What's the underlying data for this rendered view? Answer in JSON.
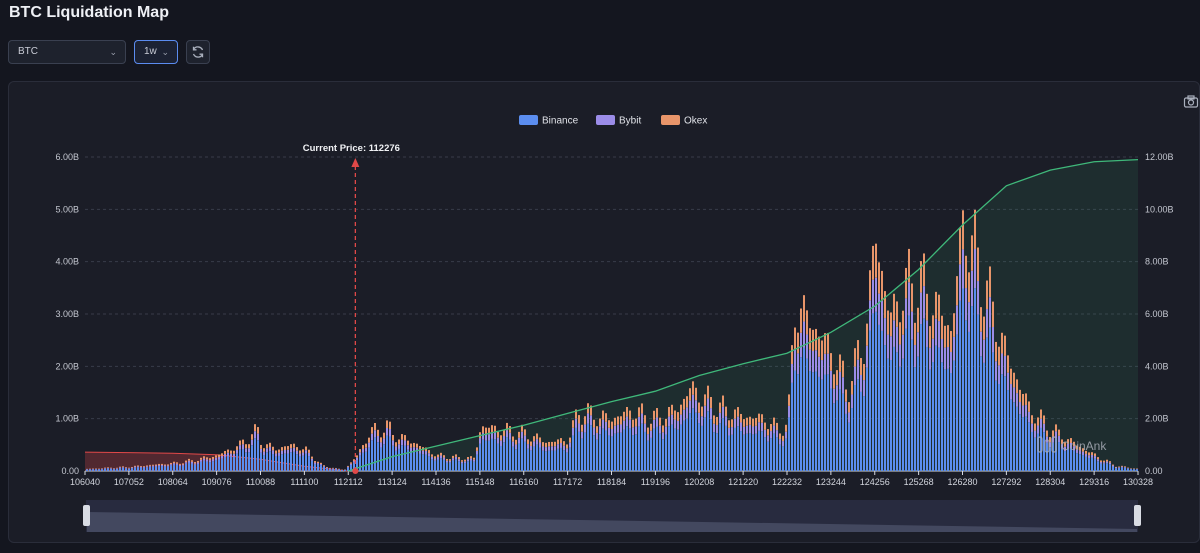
{
  "page": {
    "title": "BTC Liquidation Map"
  },
  "toolbar": {
    "symbol": "BTC",
    "timeframe": "1w"
  },
  "icons": {
    "symbol_dropdown": "chevron-down-icon",
    "timeframe_dropdown": "chevron-down-icon",
    "refresh": "refresh-icon",
    "save_image": "camera-icon"
  },
  "colors": {
    "binance": "#5b8def",
    "bybit": "#9b8ce8",
    "okex": "#e8956a",
    "cumulative_line": "#3fb87a",
    "current_price_marker": "#e04848",
    "short_cumulative": "#e04848"
  },
  "watermark": "CoinAnk",
  "chart_data": {
    "type": "bar",
    "stacked": true,
    "legend": [
      "Binance",
      "Bybit",
      "Okex"
    ],
    "legend_position": "top-center",
    "current_price_label": "Current Price:",
    "current_price": 112276,
    "x_tick_labels": [
      "106040",
      "107052",
      "108064",
      "109076",
      "110088",
      "111100",
      "112112",
      "113124",
      "114136",
      "115148",
      "116160",
      "117172",
      "118184",
      "119196",
      "120208",
      "121220",
      "122232",
      "123244",
      "124256",
      "125268",
      "126280",
      "127292",
      "128304",
      "129316",
      "130328"
    ],
    "y_left": {
      "range": [
        0,
        6
      ],
      "tick_labels": [
        "0.00",
        "1.00B",
        "2.00B",
        "3.00B",
        "4.00B",
        "5.00B",
        "6.00B"
      ]
    },
    "y_right": {
      "range": [
        0,
        12
      ],
      "tick_labels": [
        "0.00",
        "2.00B",
        "4.00B",
        "6.00B",
        "8.00B",
        "10.00B",
        "12.00B"
      ]
    },
    "grid": true,
    "liquidation_profile_billions": [
      [
        106040,
        0.04
      ],
      [
        106500,
        0.06
      ],
      [
        107052,
        0.08
      ],
      [
        107600,
        0.12
      ],
      [
        108064,
        0.15
      ],
      [
        108500,
        0.2
      ],
      [
        109076,
        0.3
      ],
      [
        109600,
        0.5
      ],
      [
        110000,
        0.78
      ],
      [
        110088,
        0.55
      ],
      [
        110400,
        0.42
      ],
      [
        110800,
        0.5
      ],
      [
        111100,
        0.42
      ],
      [
        111500,
        0.1
      ],
      [
        112000,
        0.02
      ],
      [
        112300,
        0.3
      ],
      [
        112600,
        0.75
      ],
      [
        113000,
        0.85
      ],
      [
        113124,
        0.7
      ],
      [
        113600,
        0.55
      ],
      [
        114136,
        0.3
      ],
      [
        114700,
        0.25
      ],
      [
        115000,
        0.25
      ],
      [
        115148,
        0.85
      ],
      [
        115600,
        0.8
      ],
      [
        116160,
        0.72
      ],
      [
        116700,
        0.55
      ],
      [
        117172,
        0.6
      ],
      [
        117400,
        1.15
      ],
      [
        117800,
        1.05
      ],
      [
        118184,
        1.0
      ],
      [
        118600,
        1.15
      ],
      [
        119196,
        1.0
      ],
      [
        119700,
        1.2
      ],
      [
        120000,
        1.6
      ],
      [
        120208,
        1.45
      ],
      [
        120700,
        1.2
      ],
      [
        121220,
        1.05
      ],
      [
        121700,
        1.0
      ],
      [
        122000,
        0.8
      ],
      [
        122232,
        0.9
      ],
      [
        122400,
        3.2
      ],
      [
        122800,
        2.8
      ],
      [
        123244,
        2.3
      ],
      [
        123600,
        1.6
      ],
      [
        124000,
        2.5
      ],
      [
        124256,
        4.5
      ],
      [
        124600,
        2.9
      ],
      [
        124900,
        3.5
      ],
      [
        125268,
        3.6
      ],
      [
        125700,
        3.1
      ],
      [
        126000,
        2.7
      ],
      [
        126280,
        4.8
      ],
      [
        126600,
        4.0
      ],
      [
        127292,
        2.2
      ],
      [
        127800,
        1.2
      ],
      [
        128304,
        0.8
      ],
      [
        128800,
        0.55
      ],
      [
        129316,
        0.3
      ],
      [
        129800,
        0.1
      ],
      [
        130328,
        0.04
      ]
    ],
    "cumulative_long_billions": [
      [
        112112,
        0
      ],
      [
        113124,
        0.55
      ],
      [
        114136,
        0.95
      ],
      [
        115148,
        1.35
      ],
      [
        116160,
        1.75
      ],
      [
        117172,
        2.2
      ],
      [
        118184,
        2.65
      ],
      [
        119196,
        3.05
      ],
      [
        120208,
        3.65
      ],
      [
        121220,
        4.1
      ],
      [
        122232,
        4.5
      ],
      [
        123244,
        5.3
      ],
      [
        124256,
        6.3
      ],
      [
        125268,
        7.7
      ],
      [
        126280,
        9.4
      ],
      [
        127292,
        10.9
      ],
      [
        128304,
        11.5
      ],
      [
        129316,
        11.82
      ],
      [
        130328,
        11.9
      ]
    ],
    "cumulative_short_billions": [
      [
        106040,
        0.72
      ],
      [
        107052,
        0.7
      ],
      [
        108064,
        0.68
      ],
      [
        109076,
        0.62
      ],
      [
        110088,
        0.45
      ],
      [
        111100,
        0.18
      ],
      [
        112112,
        0
      ]
    ]
  }
}
